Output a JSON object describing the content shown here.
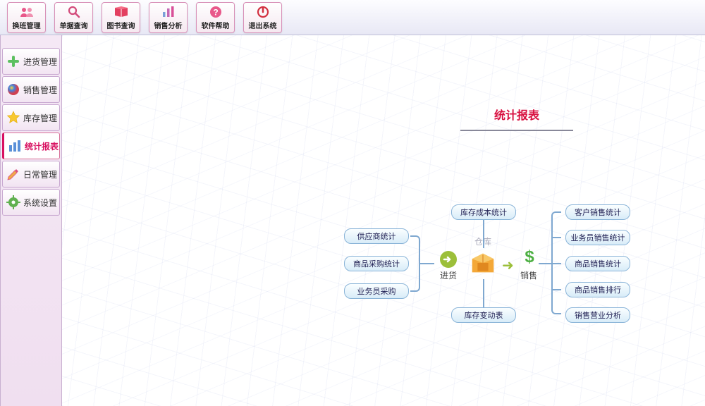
{
  "toolbar": {
    "items": [
      {
        "label": "换班管理",
        "icon": "people-icon",
        "color": "#e8588a"
      },
      {
        "label": "单据查询",
        "icon": "search-icon",
        "color": "#d24a7a"
      },
      {
        "label": "图书查询",
        "icon": "book-icon",
        "color": "#e34060"
      },
      {
        "label": "销售分析",
        "icon": "chart-icon",
        "color": "#c468b4"
      },
      {
        "label": "软件帮助",
        "icon": "help-icon",
        "color": "#e8588a"
      },
      {
        "label": "退出系统",
        "icon": "power-icon",
        "color": "#d23040"
      }
    ]
  },
  "sidebar": {
    "items": [
      {
        "label": "进货管理",
        "icon": "plus-icon",
        "color": "#5cc060",
        "active": false
      },
      {
        "label": "销售管理",
        "icon": "ball-icon",
        "color": "#4080e0",
        "active": false
      },
      {
        "label": "库存管理",
        "icon": "star-icon",
        "color": "#f8c830",
        "active": false
      },
      {
        "label": "统计报表",
        "icon": "bars-icon",
        "color": "#d81060",
        "active": true
      },
      {
        "label": "日常管理",
        "icon": "pencil-icon",
        "color": "#d85080",
        "active": false
      },
      {
        "label": "系统设置",
        "icon": "gear-icon",
        "color": "#60b050",
        "active": false
      }
    ]
  },
  "page": {
    "title": "统计报表",
    "nodes": {
      "incoming": "进货",
      "warehouse": "仓库",
      "sales": "销售"
    },
    "left_pills": [
      "供应商统计",
      "商品采购统计",
      "业务员采购"
    ],
    "mid_pills": [
      "库存成本统计",
      "库存变动表"
    ],
    "right_pills": [
      "客户销售统计",
      "业务员销售统计",
      "商品销售统计",
      "商品销售排行",
      "销售营业分析"
    ]
  }
}
